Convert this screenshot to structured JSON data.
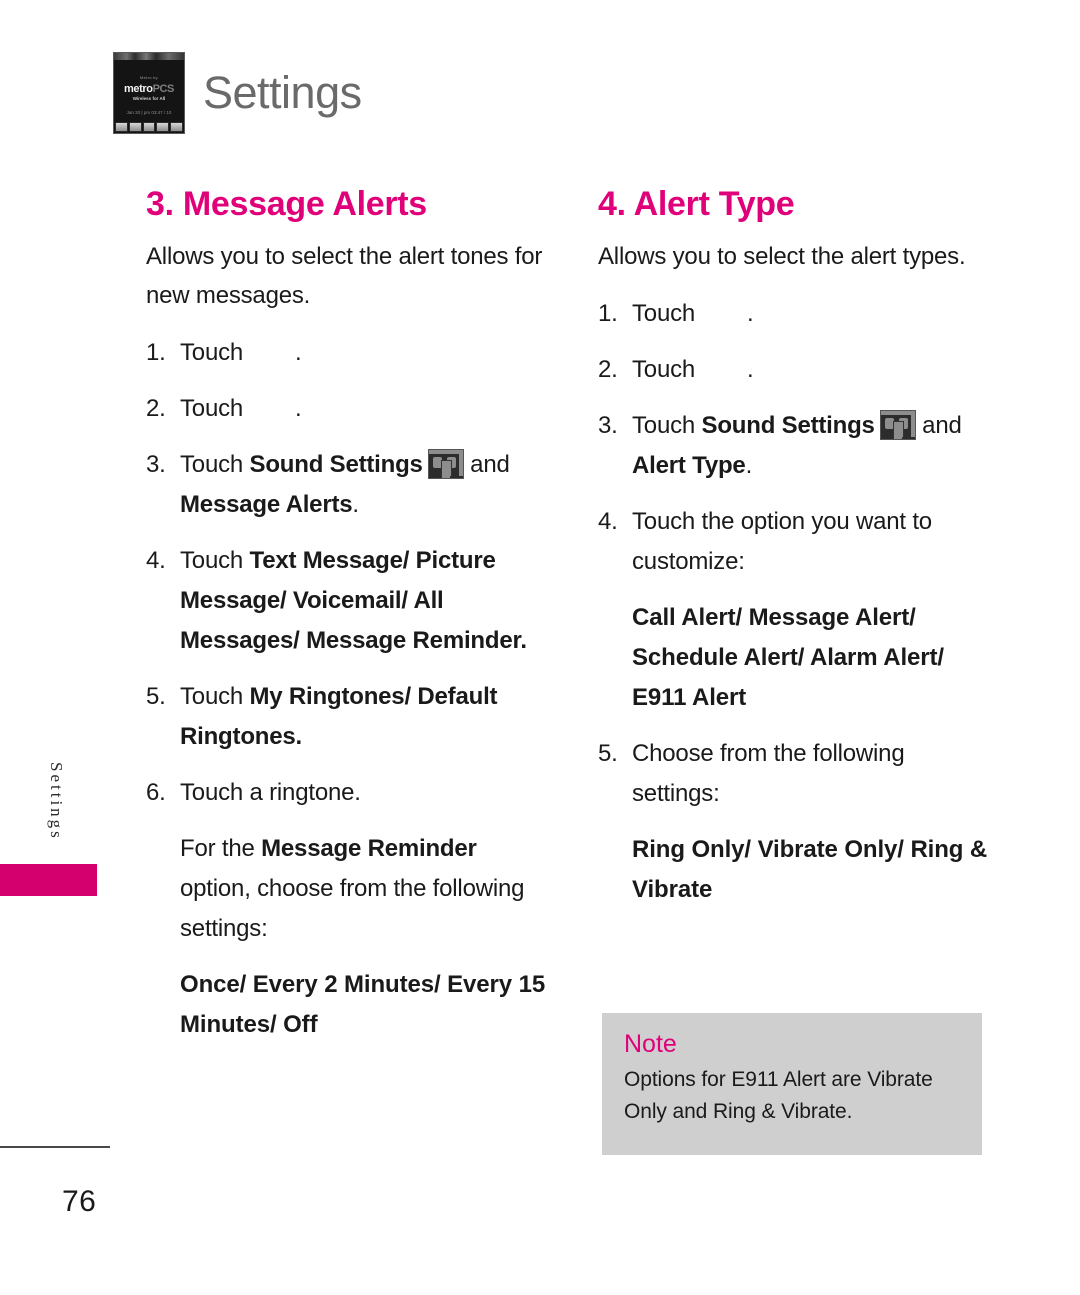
{
  "header": {
    "title": "Settings",
    "thumb": {
      "carrier": "Metro by",
      "logo_metro": "metro",
      "logo_pcs": "PCS",
      "tagline": "Wireless for All",
      "time": "Jan 20 | pm 03:47 / 10",
      "softkeys": [
        "menu",
        "message",
        "contacts",
        "camera",
        "more"
      ]
    }
  },
  "side_tab": {
    "label": "Settings"
  },
  "left_column": {
    "section_title": "3. Message Alerts",
    "intro": "Allows you to select the alert tones for new messages.",
    "steps": [
      {
        "num": "1.",
        "pre": "Touch",
        "icon": "missing-inline-icon",
        "post": "."
      },
      {
        "num": "2.",
        "pre": "Touch",
        "icon": "missing-inline-icon",
        "post": "."
      },
      {
        "num": "3.",
        "pre": "Touch ",
        "bold1": "Sound Settings",
        "icon": "menu-thumbnail-icon",
        "mid": " and ",
        "bold2": "Message Alerts",
        "post": "."
      },
      {
        "num": "4.",
        "pre": "Touch ",
        "bold1": "Text Message/ Picture Message/ Voicemail/ All Messages/ Message Reminder",
        "post": "."
      },
      {
        "num": "5.",
        "pre": "Touch ",
        "bold1": "My Ringtones/ Default Ringtones",
        "post": "."
      },
      {
        "num": "6.",
        "pre": "Touch a ringtone.",
        "post": ""
      }
    ],
    "note_para_pre": "For the ",
    "note_para_bold": "Message Reminder",
    "note_para_post": " option, choose from the following settings:",
    "options": "Once/ Every 2 Minutes/ Every 15 Minutes/ Off"
  },
  "right_column": {
    "section_title": "4. Alert Type",
    "intro": "Allows you to select the alert types.",
    "steps": [
      {
        "num": "1.",
        "pre": "Touch",
        "icon": "missing-inline-icon",
        "post": "."
      },
      {
        "num": "2.",
        "pre": "Touch",
        "icon": "missing-inline-icon",
        "post": "."
      },
      {
        "num": "3.",
        "pre": "Touch ",
        "bold1": "Sound Settings",
        "icon": "menu-thumbnail-icon",
        "mid": " and ",
        "bold2": "Alert Type",
        "post": "."
      },
      {
        "num": "4.",
        "pre": "Touch the option you want to customize:",
        "post": ""
      }
    ],
    "options_4": "Call Alert/ Message Alert/ Schedule Alert/ Alarm Alert/ E911 Alert",
    "step5_num": "5.",
    "step5_text": "Choose from the following settings:",
    "options_5": "Ring Only/ Vibrate Only/ Ring & Vibrate"
  },
  "note_box": {
    "title": "Note",
    "text": "Options for E911 Alert are Vibrate Only and Ring & Vibrate."
  },
  "footer": {
    "page_number": "76"
  },
  "colors": {
    "accent_magenta": "#e0007a",
    "tab_magenta": "#d4006e",
    "title_gray": "#6a6a6a",
    "note_bg": "#cfcfcf",
    "body_text": "#1a1a1a"
  }
}
